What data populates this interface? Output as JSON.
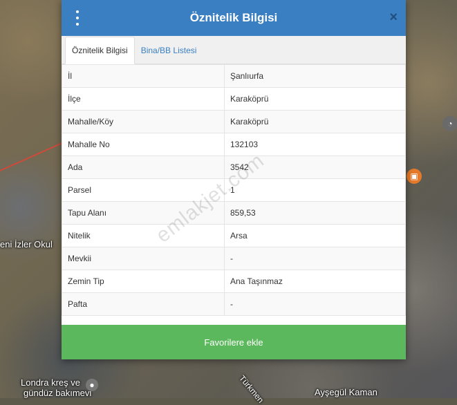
{
  "map": {
    "labels": [
      "eni İzler Okul",
      "Londra kreş ve",
      "gündüz bakımevi",
      "Türkmen",
      "Ayşegül Kaman"
    ]
  },
  "dialog": {
    "title": "Öznitelik Bilgisi",
    "menu_icon": "vertical-dots-icon",
    "close_icon": "×",
    "tabs": [
      {
        "label": "Öznitelik Bilgisi",
        "active": true
      },
      {
        "label": "Bina/BB Listesi",
        "active": false
      }
    ],
    "rows": [
      {
        "key": "İl",
        "value": "Şanlıurfa"
      },
      {
        "key": "İlçe",
        "value": "Karaköprü"
      },
      {
        "key": "Mahalle/Köy",
        "value": "Karaköprü"
      },
      {
        "key": "Mahalle No",
        "value": "132103"
      },
      {
        "key": "Ada",
        "value": "3542"
      },
      {
        "key": "Parsel",
        "value": "1"
      },
      {
        "key": "Tapu Alanı",
        "value": "859,53"
      },
      {
        "key": "Nitelik",
        "value": "Arsa"
      },
      {
        "key": "Mevkii",
        "value": "-"
      },
      {
        "key": "Zemin Tip",
        "value": "Ana Taşınmaz"
      },
      {
        "key": "Pafta",
        "value": "-"
      }
    ],
    "favorite_button": "Favorilere ekle",
    "header_color": "#3a7fc1",
    "button_color": "#5cb85c"
  },
  "watermark": "emlakjet.com"
}
